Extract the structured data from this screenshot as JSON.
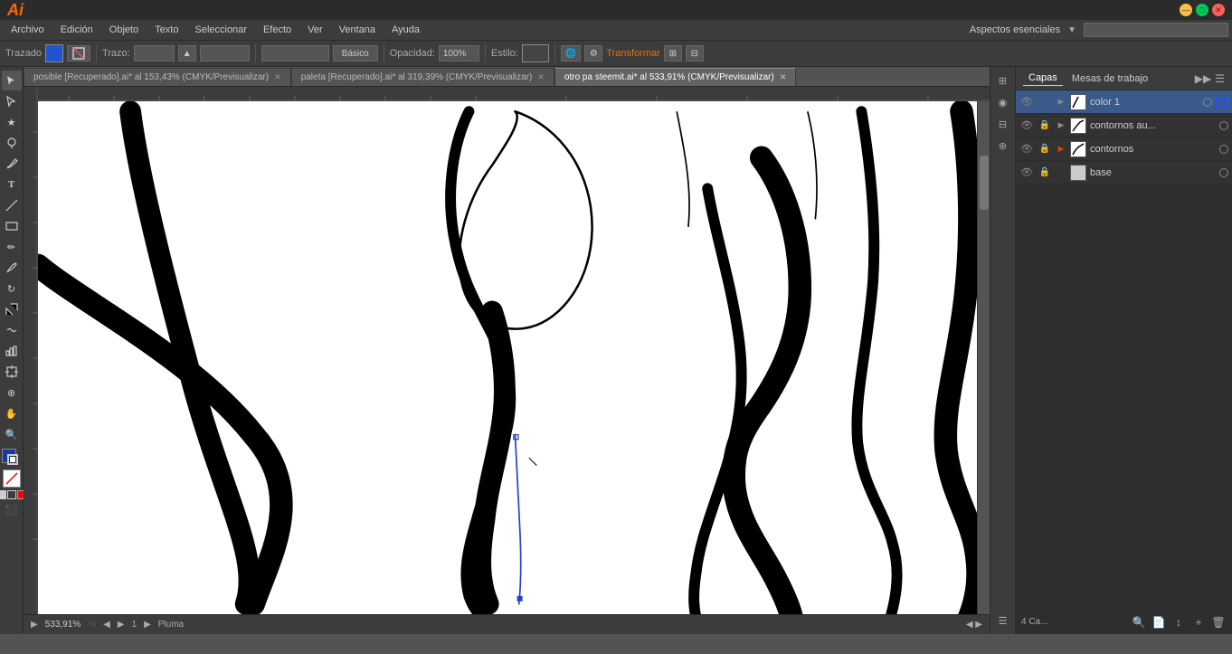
{
  "app": {
    "logo": "Ai",
    "title": "Adobe Illustrator"
  },
  "titlebar": {
    "minimize": "—",
    "maximize": "□",
    "close": "✕",
    "workspace_label": "Aspectos esenciales",
    "workspace_dropdown": "▼"
  },
  "menubar": {
    "items": [
      "Archivo",
      "Edición",
      "Objeto",
      "Texto",
      "Seleccionar",
      "Efecto",
      "Ver",
      "Ventana",
      "Ayuda"
    ],
    "search_placeholder": ""
  },
  "toolbar": {
    "trazado_label": "Trazado",
    "trazo_label": "Trazo:",
    "trazo_value": "",
    "basico_label": "Básico",
    "opacidad_label": "Opacidad:",
    "opacidad_value": "100%",
    "estilo_label": "Estilo:",
    "transformar_label": "Transformar"
  },
  "tabs": [
    {
      "label": "posible [Recuperado].ai* al 153,43% (CMYK/Previsualizar)",
      "active": false
    },
    {
      "label": "paleta [Recuperado].ai* al 319,39% (CMYK/Previsualizar)",
      "active": false
    },
    {
      "label": "otro pa steemit.ai* al 533,91% (CMYK/Previsualizar)",
      "active": true
    }
  ],
  "statusbar": {
    "zoom": "533,91%",
    "artboard": "1",
    "tool_label": "Pluma"
  },
  "layers": {
    "panel_title": "Capas",
    "panel_tab2": "Mesas de trabajo",
    "items": [
      {
        "name": "color 1",
        "visible": true,
        "locked": false,
        "selected": true,
        "has_sublayer": true,
        "color": "#2255ff"
      },
      {
        "name": "contornos au...",
        "visible": true,
        "locked": true,
        "selected": false,
        "has_sublayer": true,
        "color": "#888"
      },
      {
        "name": "contornos",
        "visible": true,
        "locked": true,
        "selected": false,
        "has_sublayer": true,
        "color": "#cc4400"
      },
      {
        "name": "base",
        "visible": true,
        "locked": true,
        "selected": false,
        "has_sublayer": false,
        "color": "#888"
      }
    ],
    "footer_count": "4 Ca...",
    "btn_add": "+",
    "btn_delete": "🗑"
  }
}
